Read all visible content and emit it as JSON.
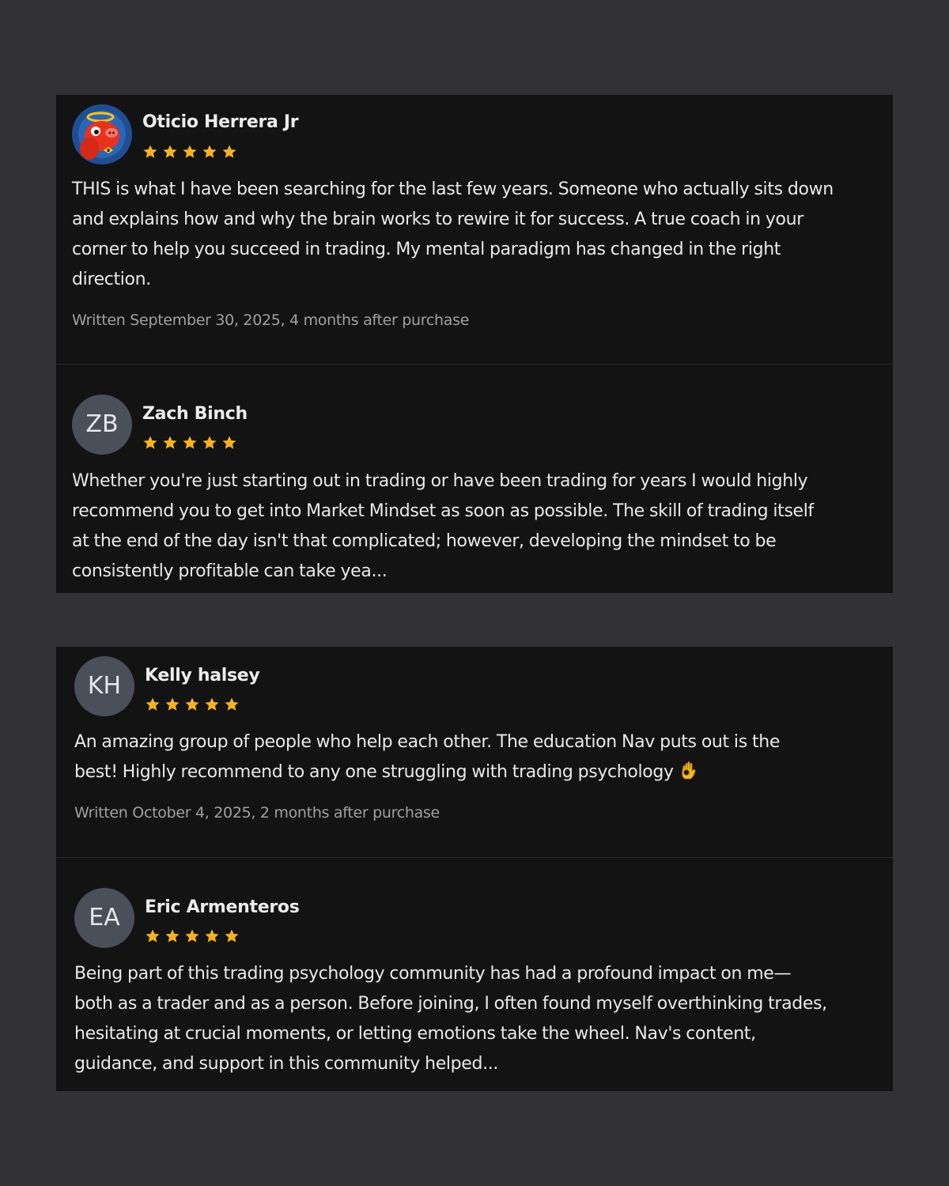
{
  "colors": {
    "page_background": "#323235",
    "card_background": "#131313",
    "star": "#f6b21e",
    "avatar_background": "#4a4f5a",
    "meta_text": "#a0a0a0"
  },
  "reviews": [
    {
      "name": "Oticio Herrera Jr",
      "avatar_initials": "",
      "avatar_icon": "cartoon-pig-avatar-icon",
      "rating": 5,
      "text": "THIS is what I have been searching for the last few years. Someone who actually sits down\nand explains how and why the brain works to rewire it for success. A true coach in your\ncorner to help you succeed in trading. My mental paradigm has changed in the right\ndirection.",
      "meta": "Written September 30, 2025, 4 months after purchase"
    },
    {
      "name": "Zach Binch",
      "avatar_initials": "ZB",
      "rating": 5,
      "text": "Whether you're just starting out in trading or have been trading for years I would highly\nrecommend you to get into Market Mindset as soon as possible. The skill of trading itself\nat the end of the day isn't that complicated; however, developing the mindset to be\nconsistently profitable can take yea...",
      "meta": ""
    },
    {
      "name": "Kelly halsey",
      "avatar_initials": "KH",
      "rating": 5,
      "text": "An amazing group of people who help each other. The education Nav puts out is the\nbest! Highly recommend to any one struggling with trading psychology",
      "emoji_icon": "ok-hand-emoji-icon",
      "meta": "Written October 4, 2025, 2 months after purchase"
    },
    {
      "name": "Eric Armenteros",
      "avatar_initials": "EA",
      "rating": 5,
      "text": "Being part of this trading psychology community has had a profound impact on me—\nboth as a trader and as a person. Before joining, I often found myself overthinking trades,\nhesitating at crucial moments, or letting emotions take the wheel. Nav's content,\nguidance, and support in this community helped...",
      "meta": ""
    }
  ]
}
